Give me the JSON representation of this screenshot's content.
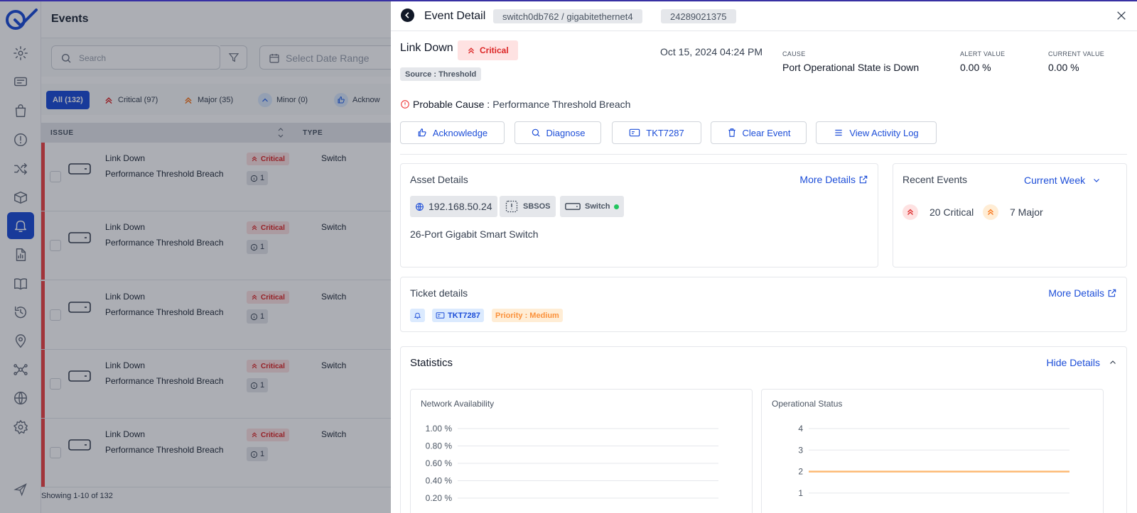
{
  "app": {
    "page_title": "Events",
    "search_placeholder": "Search",
    "date_placeholder": "Select Date Range",
    "tabs": [
      {
        "label": "All (132)",
        "kind": "all"
      },
      {
        "label": "Critical (97)",
        "kind": "critical"
      },
      {
        "label": "Major (35)",
        "kind": "major"
      },
      {
        "label": "Minor (0)",
        "kind": "minor"
      },
      {
        "label": "Acknow",
        "kind": "ack"
      }
    ],
    "table_headers": {
      "issue": "ISSUE",
      "type": "TYPE"
    },
    "rows": [
      {
        "title": "Link Down",
        "cause": "Performance Threshold Breach",
        "severity": "Critical",
        "count": "1",
        "type": "Switch"
      },
      {
        "title": "Link Down",
        "cause": "Performance Threshold Breach",
        "severity": "Critical",
        "count": "1",
        "type": "Switch"
      },
      {
        "title": "Link Down",
        "cause": "Performance Threshold Breach",
        "severity": "Critical",
        "count": "1",
        "type": "Switch"
      },
      {
        "title": "Link Down",
        "cause": "Performance Threshold Breach",
        "severity": "Critical",
        "count": "1",
        "type": "Switch"
      },
      {
        "title": "Link Down",
        "cause": "Performance Threshold Breach",
        "severity": "Critical",
        "count": "1",
        "type": "Switch"
      }
    ],
    "footer": "Showing 1-10 of 132",
    "sidebar_icons": [
      "gear-icon",
      "ticket-icon",
      "bag-icon",
      "alert-icon",
      "shuffle-icon",
      "box-icon",
      "bell-icon",
      "report-icon",
      "book-icon",
      "history-icon",
      "location-icon",
      "topology-icon",
      "globe-icon",
      "settings-icon"
    ],
    "active_sidebar": "bell-icon"
  },
  "panel": {
    "title": "Event Detail",
    "interface_path": "switch0db762 / gigabitethernet4",
    "event_id": "24289021375",
    "event_name": "Link Down",
    "severity": "Critical",
    "source": "Source : Threshold",
    "datetime": "Oct 15, 2024 04:24 PM",
    "cause_label": "CAUSE",
    "cause_value": "Port Operational State is Down",
    "alert_label": "ALERT VALUE",
    "alert_value": "0.00 %",
    "current_label": "CURRENT VALUE",
    "current_value": "0.00 %",
    "probable_label": "Probable Cause :",
    "probable_value": "Performance Threshold Breach",
    "actions": {
      "acknowledge": "Acknowledge",
      "diagnose": "Diagnose",
      "ticket": "TKT7287",
      "clear": "Clear Event",
      "activity": "View Activity Log"
    },
    "asset": {
      "title": "Asset Details",
      "more": "More Details",
      "ip": "192.168.50.24",
      "os": "SBSOS",
      "device_type": "Switch",
      "description": "26-Port Gigabit Smart Switch"
    },
    "recent": {
      "title": "Recent Events",
      "range": "Current Week",
      "critical": "20 Critical",
      "major": "7 Major"
    },
    "ticket": {
      "title": "Ticket details",
      "more": "More Details",
      "id": "TKT7287",
      "priority": "Priority : Medium"
    },
    "statistics": {
      "title": "Statistics",
      "toggle": "Hide Details"
    },
    "colors": {
      "accent": "#1d4ed8",
      "critical": "#dc2626",
      "critical_bg": "#fee2e2",
      "major": "#f97316",
      "online": "#22c55e"
    }
  },
  "chart_data": [
    {
      "type": "line",
      "title": "Network Availability",
      "yticks": [
        "1.00 %",
        "0.80 %",
        "0.60 %",
        "0.40 %",
        "0.20 %"
      ],
      "ylim": [
        0,
        1
      ],
      "series": []
    },
    {
      "type": "line",
      "title": "Operational Status",
      "yticks": [
        "4",
        "3",
        "2",
        "1"
      ],
      "ylim": [
        0,
        4
      ],
      "series": [
        {
          "values": [
            2,
            2
          ]
        }
      ]
    }
  ]
}
